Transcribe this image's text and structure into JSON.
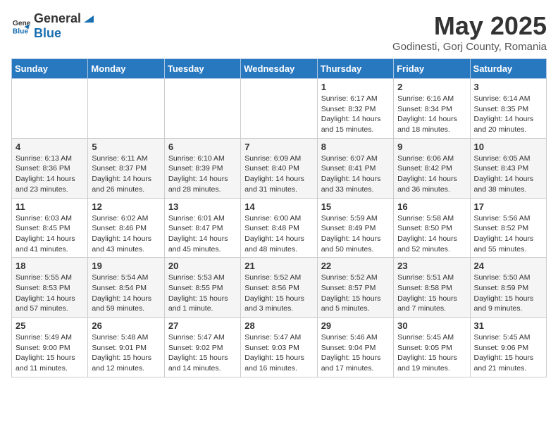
{
  "header": {
    "logo_general": "General",
    "logo_blue": "Blue",
    "month_year": "May 2025",
    "location": "Godinesti, Gorj County, Romania"
  },
  "weekdays": [
    "Sunday",
    "Monday",
    "Tuesday",
    "Wednesday",
    "Thursday",
    "Friday",
    "Saturday"
  ],
  "weeks": [
    [
      {
        "day": "",
        "info": ""
      },
      {
        "day": "",
        "info": ""
      },
      {
        "day": "",
        "info": ""
      },
      {
        "day": "",
        "info": ""
      },
      {
        "day": "1",
        "info": "Sunrise: 6:17 AM\nSunset: 8:32 PM\nDaylight: 14 hours\nand 15 minutes."
      },
      {
        "day": "2",
        "info": "Sunrise: 6:16 AM\nSunset: 8:34 PM\nDaylight: 14 hours\nand 18 minutes."
      },
      {
        "day": "3",
        "info": "Sunrise: 6:14 AM\nSunset: 8:35 PM\nDaylight: 14 hours\nand 20 minutes."
      }
    ],
    [
      {
        "day": "4",
        "info": "Sunrise: 6:13 AM\nSunset: 8:36 PM\nDaylight: 14 hours\nand 23 minutes."
      },
      {
        "day": "5",
        "info": "Sunrise: 6:11 AM\nSunset: 8:37 PM\nDaylight: 14 hours\nand 26 minutes."
      },
      {
        "day": "6",
        "info": "Sunrise: 6:10 AM\nSunset: 8:39 PM\nDaylight: 14 hours\nand 28 minutes."
      },
      {
        "day": "7",
        "info": "Sunrise: 6:09 AM\nSunset: 8:40 PM\nDaylight: 14 hours\nand 31 minutes."
      },
      {
        "day": "8",
        "info": "Sunrise: 6:07 AM\nSunset: 8:41 PM\nDaylight: 14 hours\nand 33 minutes."
      },
      {
        "day": "9",
        "info": "Sunrise: 6:06 AM\nSunset: 8:42 PM\nDaylight: 14 hours\nand 36 minutes."
      },
      {
        "day": "10",
        "info": "Sunrise: 6:05 AM\nSunset: 8:43 PM\nDaylight: 14 hours\nand 38 minutes."
      }
    ],
    [
      {
        "day": "11",
        "info": "Sunrise: 6:03 AM\nSunset: 8:45 PM\nDaylight: 14 hours\nand 41 minutes."
      },
      {
        "day": "12",
        "info": "Sunrise: 6:02 AM\nSunset: 8:46 PM\nDaylight: 14 hours\nand 43 minutes."
      },
      {
        "day": "13",
        "info": "Sunrise: 6:01 AM\nSunset: 8:47 PM\nDaylight: 14 hours\nand 45 minutes."
      },
      {
        "day": "14",
        "info": "Sunrise: 6:00 AM\nSunset: 8:48 PM\nDaylight: 14 hours\nand 48 minutes."
      },
      {
        "day": "15",
        "info": "Sunrise: 5:59 AM\nSunset: 8:49 PM\nDaylight: 14 hours\nand 50 minutes."
      },
      {
        "day": "16",
        "info": "Sunrise: 5:58 AM\nSunset: 8:50 PM\nDaylight: 14 hours\nand 52 minutes."
      },
      {
        "day": "17",
        "info": "Sunrise: 5:56 AM\nSunset: 8:52 PM\nDaylight: 14 hours\nand 55 minutes."
      }
    ],
    [
      {
        "day": "18",
        "info": "Sunrise: 5:55 AM\nSunset: 8:53 PM\nDaylight: 14 hours\nand 57 minutes."
      },
      {
        "day": "19",
        "info": "Sunrise: 5:54 AM\nSunset: 8:54 PM\nDaylight: 14 hours\nand 59 minutes."
      },
      {
        "day": "20",
        "info": "Sunrise: 5:53 AM\nSunset: 8:55 PM\nDaylight: 15 hours\nand 1 minute."
      },
      {
        "day": "21",
        "info": "Sunrise: 5:52 AM\nSunset: 8:56 PM\nDaylight: 15 hours\nand 3 minutes."
      },
      {
        "day": "22",
        "info": "Sunrise: 5:52 AM\nSunset: 8:57 PM\nDaylight: 15 hours\nand 5 minutes."
      },
      {
        "day": "23",
        "info": "Sunrise: 5:51 AM\nSunset: 8:58 PM\nDaylight: 15 hours\nand 7 minutes."
      },
      {
        "day": "24",
        "info": "Sunrise: 5:50 AM\nSunset: 8:59 PM\nDaylight: 15 hours\nand 9 minutes."
      }
    ],
    [
      {
        "day": "25",
        "info": "Sunrise: 5:49 AM\nSunset: 9:00 PM\nDaylight: 15 hours\nand 11 minutes."
      },
      {
        "day": "26",
        "info": "Sunrise: 5:48 AM\nSunset: 9:01 PM\nDaylight: 15 hours\nand 12 minutes."
      },
      {
        "day": "27",
        "info": "Sunrise: 5:47 AM\nSunset: 9:02 PM\nDaylight: 15 hours\nand 14 minutes."
      },
      {
        "day": "28",
        "info": "Sunrise: 5:47 AM\nSunset: 9:03 PM\nDaylight: 15 hours\nand 16 minutes."
      },
      {
        "day": "29",
        "info": "Sunrise: 5:46 AM\nSunset: 9:04 PM\nDaylight: 15 hours\nand 17 minutes."
      },
      {
        "day": "30",
        "info": "Sunrise: 5:45 AM\nSunset: 9:05 PM\nDaylight: 15 hours\nand 19 minutes."
      },
      {
        "day": "31",
        "info": "Sunrise: 5:45 AM\nSunset: 9:06 PM\nDaylight: 15 hours\nand 21 minutes."
      }
    ]
  ]
}
